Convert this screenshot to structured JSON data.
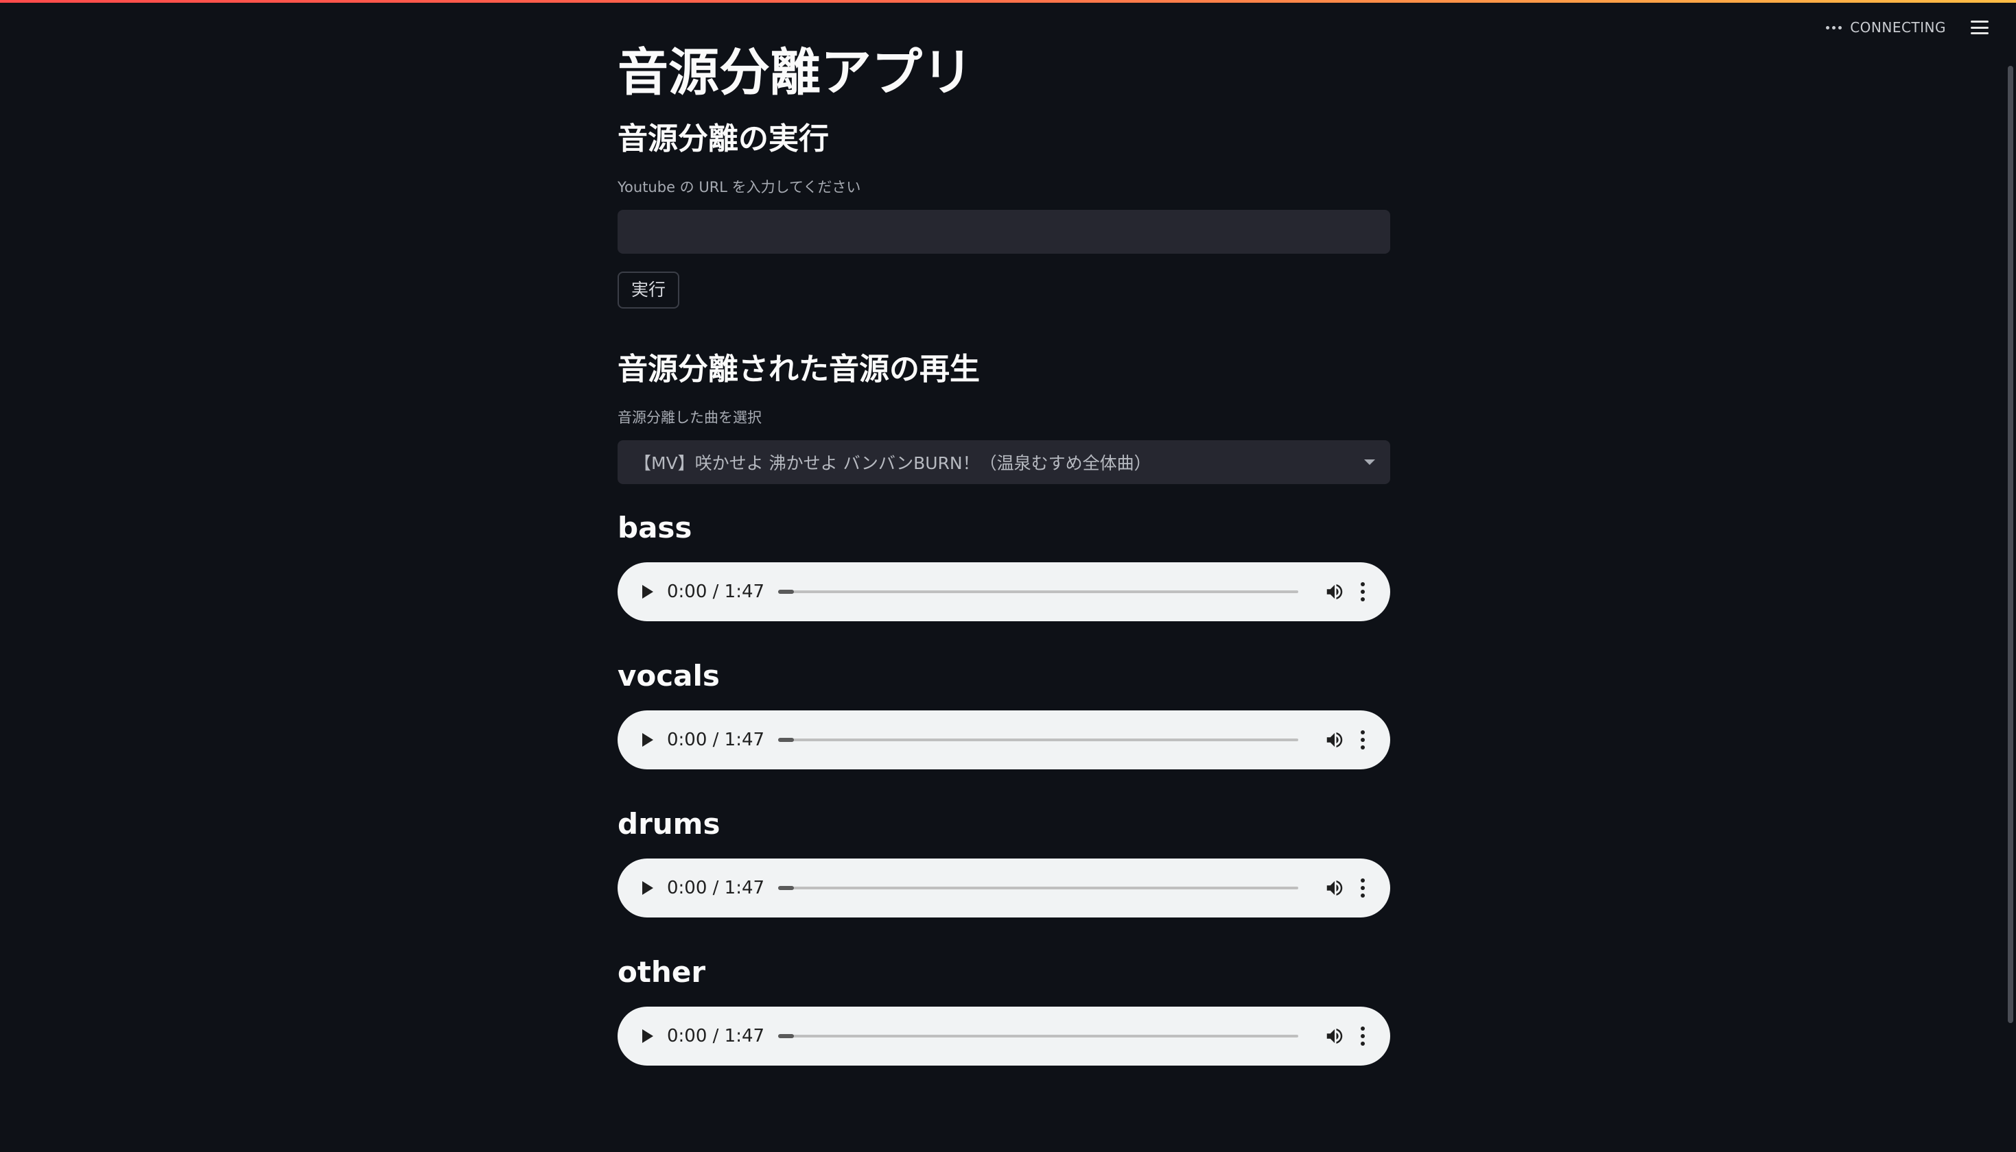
{
  "header": {
    "status_text": "CONNECTING",
    "status_icon": "more-horizontal-icon",
    "menu_icon": "hamburger-menu-icon"
  },
  "colors": {
    "background": "#0e1117",
    "input_background": "#262730",
    "accent_gradient_start": "#ff4b4b",
    "accent_gradient_end": "#ffbd45",
    "player_background": "#f1f3f4"
  },
  "page": {
    "title": "音源分離アプリ"
  },
  "run_section": {
    "heading": "音源分離の実行",
    "url_label": "Youtube の URL を入力してください",
    "url_value": "",
    "run_button_label": "実行"
  },
  "playback_section": {
    "heading": "音源分離された音源の再生",
    "select_label": "音源分離した曲を選択",
    "selected_song": "【MV】咲かせよ 沸かせよ バンバンBURN！（温泉むすめ全体曲）"
  },
  "stems": [
    {
      "name": "bass",
      "time": "0:00 / 1:47",
      "progress": 0.03
    },
    {
      "name": "vocals",
      "time": "0:00 / 1:47",
      "progress": 0.03
    },
    {
      "name": "drums",
      "time": "0:00 / 1:47",
      "progress": 0.03
    },
    {
      "name": "other",
      "time": "0:00 / 1:47",
      "progress": 0.03
    }
  ]
}
